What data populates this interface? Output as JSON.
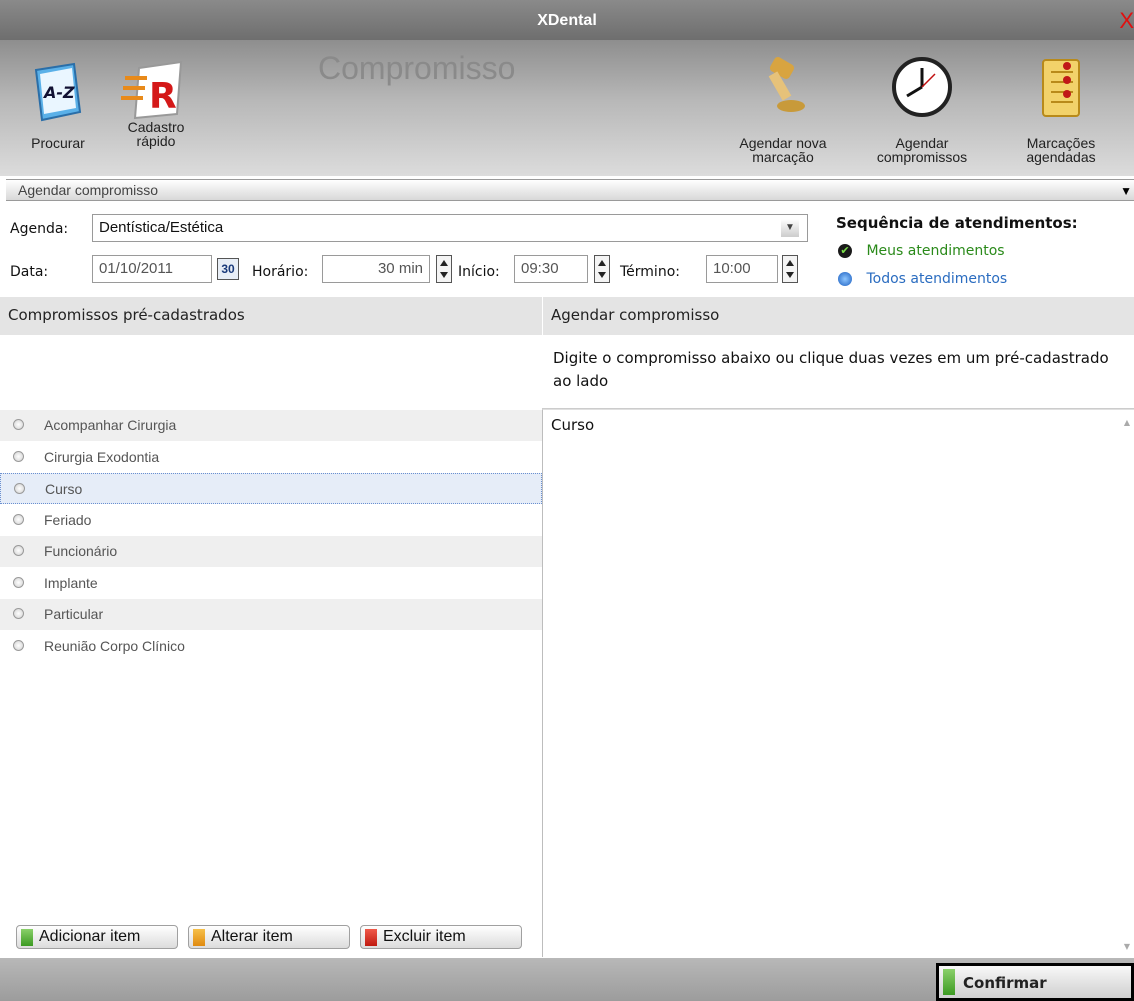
{
  "window": {
    "title": "XDental",
    "close_glyph": "X"
  },
  "toolbar": {
    "heading": "Compromisso",
    "procurar": {
      "label": "Procurar",
      "icon": "az-book-icon"
    },
    "cadastro": {
      "line1": "Cadastro",
      "line2": "rápido",
      "icon": "red-r-icon"
    },
    "agendar_nova": {
      "line1": "Agendar nova",
      "line2": "marcação",
      "icon": "stamp-icon"
    },
    "agendar_comp": {
      "line1": "Agendar",
      "line2": "compromissos",
      "icon": "clock-icon"
    },
    "marcacoes": {
      "line1": "Marcações",
      "line2": "agendadas",
      "icon": "notebook-icon"
    }
  },
  "section": {
    "title": "Agendar compromisso"
  },
  "form": {
    "agenda_label": "Agenda:",
    "agenda_value": "Dentística/Estética",
    "data_label": "Data:",
    "data_value": "01/10/2011",
    "calendar_day": "30",
    "horario_label": "Horário:",
    "horario_value": "30 min",
    "inicio_label": "Início:",
    "inicio_value": "09:30",
    "termino_label": "Término:",
    "termino_value": "10:00"
  },
  "sequencia": {
    "title": "Sequência de atendimentos:",
    "meus": "Meus atendimentos",
    "todos": "Todos atendimentos",
    "meus_color": "#2a8a1a",
    "todos_color": "#2a6cc0"
  },
  "left_panel": {
    "header": "Compromissos pré-cadastrados",
    "items": [
      "Acompanhar Cirurgia",
      "Cirurgia Exodontia",
      "Curso",
      "Feriado",
      "Funcionário",
      "Implante",
      "Particular",
      "Reunião Corpo Clínico"
    ],
    "selected_index": 2,
    "buttons": {
      "add": "Adicionar item",
      "edit": "Alterar item",
      "delete": "Excluir item"
    }
  },
  "right_panel": {
    "header": "Agendar compromisso",
    "instruction": "Digite o compromisso abaixo ou clique duas vezes em um pré-cadastrado ao lado",
    "text": "Curso"
  },
  "footer": {
    "confirm": "Confirmar"
  }
}
